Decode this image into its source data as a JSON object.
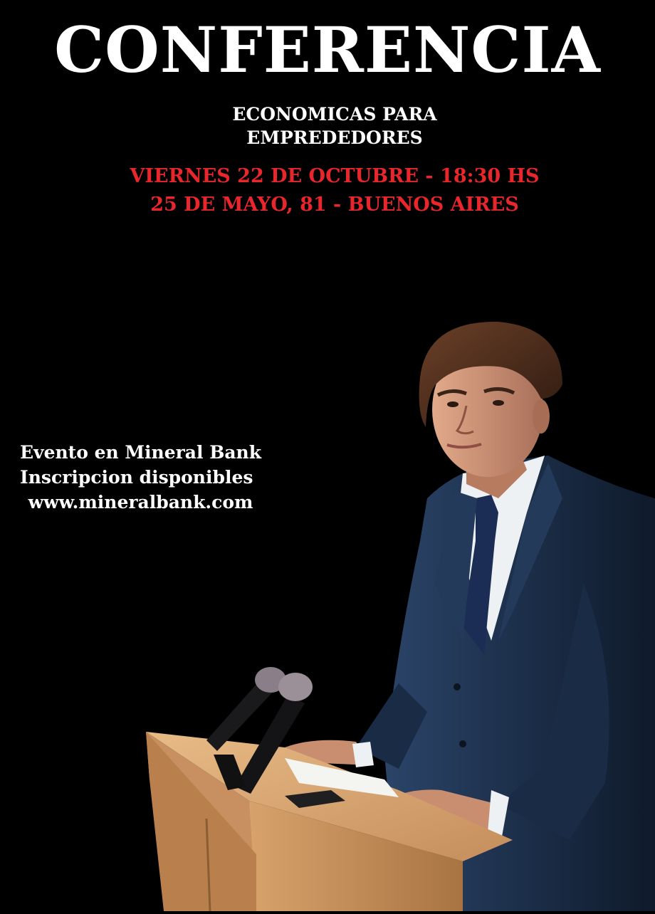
{
  "poster": {
    "title": "CONFERENCIA",
    "subtitle_lines": [
      "ECONOMICAS PARA",
      "EMPREDEDORES"
    ],
    "detail_lines": [
      "VIERNES 22 DE OCTUBRE - 18:30 HS",
      "25 DE MAYO, 81 - BUENOS AIRES"
    ],
    "info_lines": [
      "Evento en Mineral Bank",
      "Inscripcion disponibles",
      "www.mineralbank.com"
    ]
  },
  "colors": {
    "background": "#000000",
    "title": "#ffffff",
    "accent": "#e8262b",
    "suit": "#1c2f4a",
    "podium": "#d9a874"
  },
  "illustration": {
    "subject": "speaker-at-podium",
    "icons": [
      "microphone-icon",
      "phone-icon"
    ]
  }
}
